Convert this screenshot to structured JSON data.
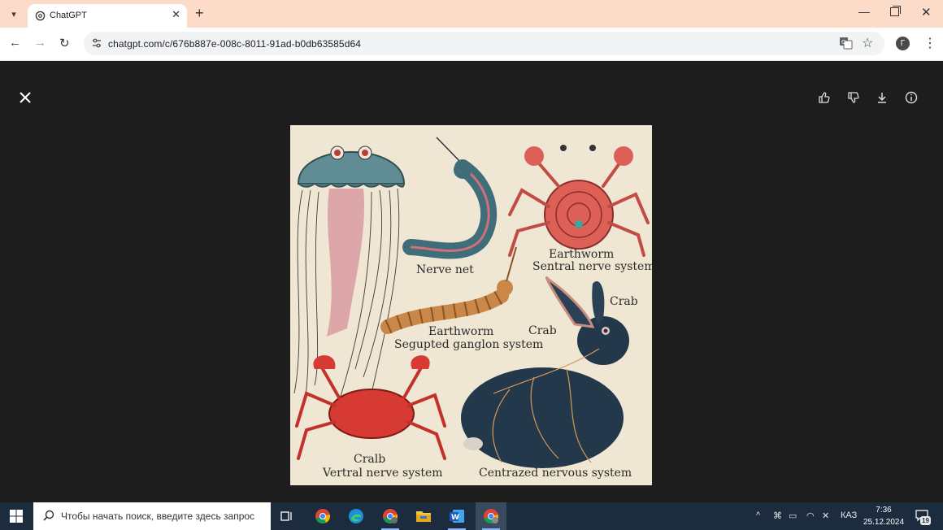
{
  "browser": {
    "tab_title": "ChatGPT",
    "tab_close": "✕",
    "new_tab": "+",
    "url": "chatgpt.com/c/676b887e-008c-8011-91ad-b0db63585d64",
    "profile_initial": "Г",
    "window_controls": {
      "minimize": "—",
      "close": "✕"
    }
  },
  "viewer": {
    "actions": [
      "thumbs-up",
      "thumbs-down",
      "download",
      "info"
    ],
    "image_labels": {
      "nerve_net": "Nerve net",
      "earthworm_top": "Earthworm",
      "sentral": "Sentral nerve system",
      "crab_right": "Crab",
      "earthworm_mid": "Earthworm",
      "crab_mid": "Crab",
      "segmented": "Segupted ganglon system",
      "crab_bottom": "Cralb",
      "vertral": "Vertral nerve system",
      "centrazed": "Centrazed nervous system"
    }
  },
  "taskbar": {
    "search_placeholder": "Чтобы начать поиск, введите здесь запрос",
    "apps": [
      "task-view",
      "chrome",
      "edge",
      "chrome-profile",
      "file-explorer",
      "word",
      "chrome-active"
    ],
    "language": "КАЗ",
    "time": "7:36",
    "date": "25.12.2024",
    "notification_count": "19"
  },
  "colors": {
    "tabstrip": "#fcdcc8",
    "viewer_bg": "#1d1d1d",
    "taskbar": "#1c2b3e",
    "image_bg": "#efe6d3"
  }
}
